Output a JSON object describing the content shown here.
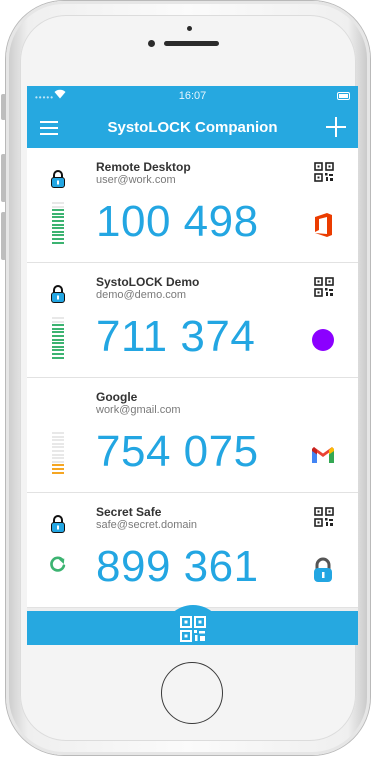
{
  "status_bar": {
    "time": "16:07",
    "signal": "•••••"
  },
  "nav": {
    "title": "SystoLOCK Companion"
  },
  "accounts": [
    {
      "name": "Remote Desktop",
      "user": "user@work.com",
      "code": "100 498",
      "brand": "office",
      "brand_color": "#eb3c00",
      "progress_color": "#3cb371",
      "has_lock": true,
      "has_qr": true
    },
    {
      "name": "SystoLOCK Demo",
      "user": "demo@demo.com",
      "code": "711 374",
      "brand": "purple-circle",
      "brand_color": "#8b00ff",
      "progress_color": "#3cb371",
      "has_lock": true,
      "has_qr": true
    },
    {
      "name": "Google",
      "user": "work@gmail.com",
      "code": "754 075",
      "brand": "gmail",
      "brand_color": "#ea4335",
      "progress_color": "#f5a623",
      "has_lock": false,
      "has_qr": false
    },
    {
      "name": "Secret Safe",
      "user": "safe@secret.domain",
      "code": "899 361",
      "brand": "lock",
      "brand_color": "#23a6e2",
      "progress_color": "#3cb371",
      "has_lock": true,
      "has_qr": true
    }
  ],
  "colors": {
    "accent": "#26a8e0",
    "code": "#23a6e2"
  }
}
